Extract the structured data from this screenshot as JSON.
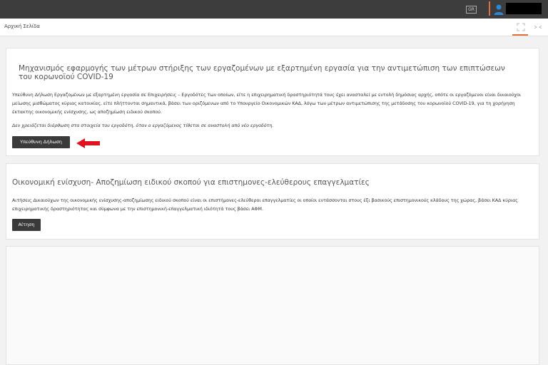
{
  "topbar": {
    "lang_label": "GR",
    "user_icon": "user-icon"
  },
  "header": {
    "breadcrumb": "Αρχική Σελίδα",
    "expand_icon": "expand-icon",
    "more_icon": "more-icon"
  },
  "panel1": {
    "title": "Μηχανισμός εφαρμογής των μέτρων στήριξης των εργαζομένων με εξαρτημένη εργασία για την αντιμετώπιση των επιπτώσεων του κορωνοϊού COVID-19",
    "description": "Υπεύθυνη Δήλωση Εργαζομένων με εξαρτημένη εργασία σε Επιχειρήσεις – Εργοδότες των οποίων, είτε η επιχειρηματική δραστηριότητά τους έχει ανασταλεί με εντολή δημόσιας αρχής, οπότε οι εργαζόμενοι είναι δικαιούχοι μείωσης μισθώματος κύριας κατοικίας, είτε πλήττονται σημαντικά, βάσει των οριζόμενων από το Υπουργείο Οικονομικών ΚΑΔ, λόγω των μέτρων αντιμετώπισης της μετάδοσης του κορωνοϊού COVID-19, για τη χορήγηση έκτακτης οικονομικής ενίσχυσης, ως αποζημίωση ειδικού σκοπού.",
    "note": "Δεν χρειάζεται διόρθωση στα στοιχεία του εργοδότη, όταν ο εργαζόμενος τίθεται σε αναστολή από νέο εργοδότη.",
    "button_label": "Υπεύθυνη Δήλωση"
  },
  "panel2": {
    "title": "Οικονομική ενίσχυση- Αποζημίωση ειδικού σκοπού για επιστημονες-ελεύθερους επαγγελματίες",
    "description": "Αιτήσεις Δικαιούχων της οικονομικής ενίσχυσης-αποζημίωσης ειδικού σκοπού είναι οι επιστήμονες-ελεύθεροι επαγγελματίες οι οποίοι εντάσσονται στους έξι βασικούς επιστημονικούς κλάδους της χώρας, βάσει ΚΑΔ κύριας επιχειρηματικής δραστηριότητας και σύμφωνα με την επιστημονική-επαγγελματική ιδιότητά τους βάσει ΑΦΜ.",
    "button_label": "Αίτηση"
  },
  "colors": {
    "accent": "#e2703a",
    "topbar": "#3d3d3d",
    "button": "#3a3a3a",
    "arrow": "#e0141e"
  }
}
